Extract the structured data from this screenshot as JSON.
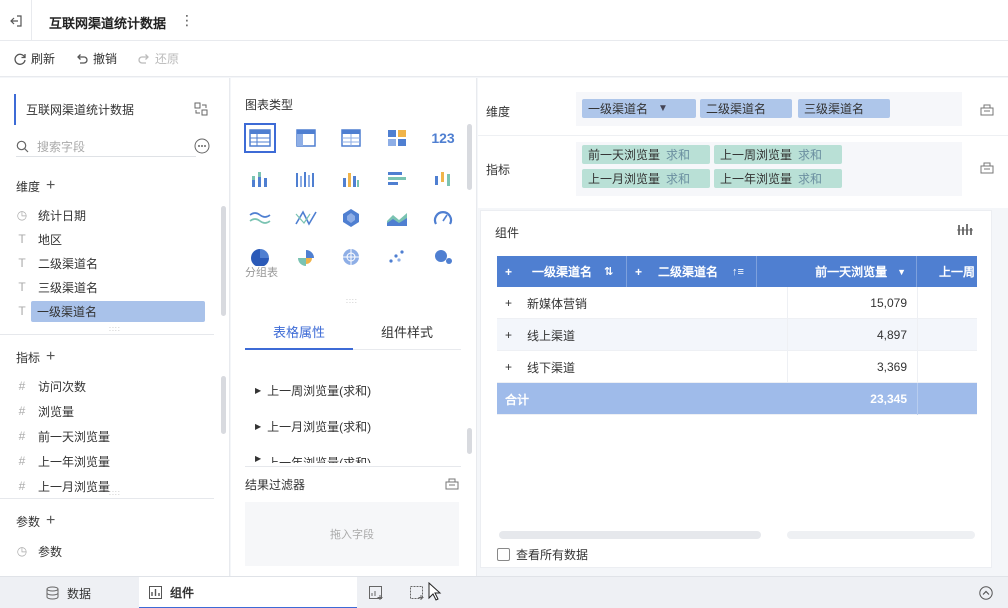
{
  "header": {
    "title": "互联网渠道统计数据"
  },
  "toolbar": {
    "refresh": "刷新",
    "undo": "撤销",
    "redo": "还原"
  },
  "left": {
    "dataset": "互联网渠道统计数据",
    "search_placeholder": "搜索字段",
    "dimension_title": "维度",
    "dimensions": [
      "统计日期",
      "地区",
      "二级渠道名",
      "三级渠道名",
      "一级渠道名"
    ],
    "measure_title": "指标",
    "measures": [
      "访问次数",
      "浏览量",
      "前一天浏览量",
      "上一年浏览量",
      "上一月浏览量"
    ],
    "param_title": "参数",
    "params": [
      "参数"
    ]
  },
  "middle": {
    "chart_type_title": "图表类型",
    "group_label": "分组表",
    "tabs": [
      "表格属性",
      "组件样式"
    ],
    "properties": [
      "上一周浏览量(求和)",
      "上一月浏览量(求和)",
      "上一年浏览量(求和)"
    ],
    "filter_title": "结果过滤器",
    "drop_hint": "拖入字段"
  },
  "config": {
    "dimension_label": "维度",
    "dimension_chips": [
      "一级渠道名",
      "二级渠道名",
      "三级渠道名"
    ],
    "measure_label": "指标",
    "measure_chips": [
      {
        "name": "前一天浏览量",
        "agg": "求和"
      },
      {
        "name": "上一周浏览量",
        "agg": "求和"
      },
      {
        "name": "上一月浏览量",
        "agg": "求和"
      },
      {
        "name": "上一年浏览量",
        "agg": "求和"
      }
    ]
  },
  "widget": {
    "title": "组件",
    "columns": [
      "一级渠道名",
      "二级渠道名",
      "前一天浏览量",
      "上一周"
    ],
    "rows": [
      {
        "name": "新媒体营销",
        "value": "15,079"
      },
      {
        "name": "线上渠道",
        "value": "4,897"
      },
      {
        "name": "线下渠道",
        "value": "3,369"
      }
    ],
    "total_label": "合计",
    "total_value": "23,345",
    "view_all": "查看所有数据"
  },
  "bottom": {
    "tabs": [
      "数据",
      "组件"
    ]
  }
}
